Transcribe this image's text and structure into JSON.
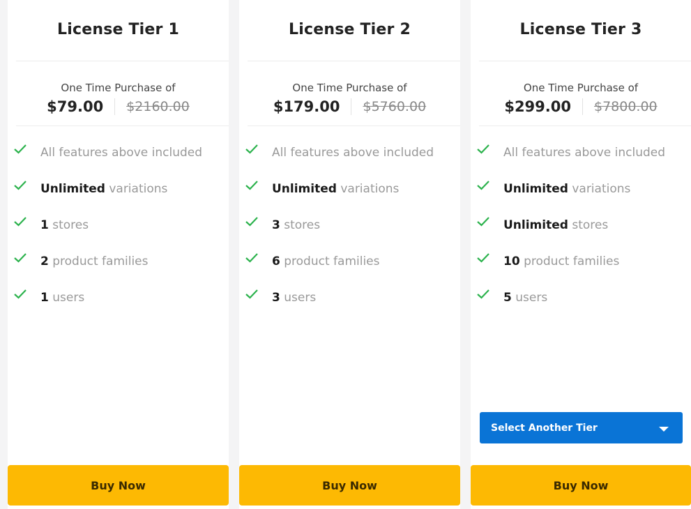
{
  "colors": {
    "accent_buy": "#fdb903",
    "accent_select": "#0a74d6",
    "check": "#2bb24c"
  },
  "tiers": [
    {
      "title": "License Tier 1",
      "purchase_label": "One Time Purchase of",
      "price": "$79.00",
      "old_price": "$2160.00",
      "features": [
        {
          "bold": "",
          "text": "All features above included"
        },
        {
          "bold": "Unlimited",
          "text": " variations"
        },
        {
          "bold": "1",
          "text": " stores"
        },
        {
          "bold": "2",
          "text": " product families"
        },
        {
          "bold": "1",
          "text": " users"
        }
      ],
      "buy_label": "Buy Now"
    },
    {
      "title": "License Tier 2",
      "purchase_label": "One Time Purchase of",
      "price": "$179.00",
      "old_price": "$5760.00",
      "features": [
        {
          "bold": "",
          "text": "All features above included"
        },
        {
          "bold": "Unlimited",
          "text": " variations"
        },
        {
          "bold": "3",
          "text": " stores"
        },
        {
          "bold": "6",
          "text": " product families"
        },
        {
          "bold": "3",
          "text": " users"
        }
      ],
      "buy_label": "Buy Now"
    },
    {
      "title": "License Tier 3",
      "purchase_label": "One Time Purchase of",
      "price": "$299.00",
      "old_price": "$7800.00",
      "features": [
        {
          "bold": "",
          "text": "All features above included"
        },
        {
          "bold": "Unlimited",
          "text": " variations"
        },
        {
          "bold": "Unlimited",
          "text": " stores"
        },
        {
          "bold": "10",
          "text": " product families"
        },
        {
          "bold": "5",
          "text": " users"
        }
      ],
      "select_label": "Select Another Tier",
      "buy_label": "Buy Now"
    }
  ]
}
